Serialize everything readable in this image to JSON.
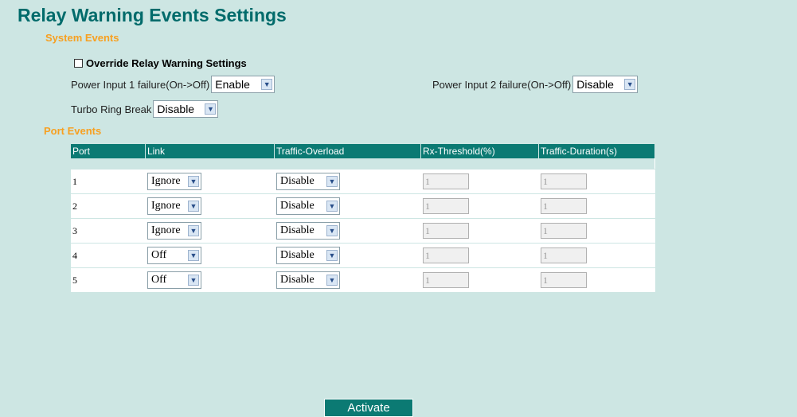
{
  "title": "Relay Warning Events Settings",
  "system_events": {
    "heading": "System Events",
    "override_label": "Override Relay Warning Settings",
    "power1_label": "Power Input 1 failure(On->Off)",
    "power1_value": "Enable",
    "power2_label": "Power Input 2 failure(On->Off)",
    "power2_value": "Disable",
    "turbo_label": "Turbo Ring Break",
    "turbo_value": "Disable"
  },
  "port_events": {
    "heading": "Port Events",
    "columns": [
      "Port",
      "Link",
      "Traffic-Overload",
      "Rx-Threshold(%)",
      "Traffic-Duration(s)"
    ],
    "rows": [
      {
        "port": "1",
        "link": "Ignore",
        "overload": "Disable",
        "rx": "1",
        "duration": "1"
      },
      {
        "port": "2",
        "link": "Ignore",
        "overload": "Disable",
        "rx": "1",
        "duration": "1"
      },
      {
        "port": "3",
        "link": "Ignore",
        "overload": "Disable",
        "rx": "1",
        "duration": "1"
      },
      {
        "port": "4",
        "link": "Off",
        "overload": "Disable",
        "rx": "1",
        "duration": "1"
      },
      {
        "port": "5",
        "link": "Off",
        "overload": "Disable",
        "rx": "1",
        "duration": "1"
      }
    ]
  },
  "activate_label": "Activate"
}
